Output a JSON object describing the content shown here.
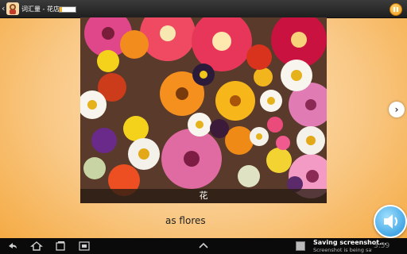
{
  "header": {
    "title": "词汇量 - 花店",
    "progress_fraction": 0.15
  },
  "card": {
    "caption": "花",
    "word": "as flores"
  },
  "statusbar": {
    "notification_title": "Saving screenshot...",
    "notification_subtitle": "Screenshot is being saved",
    "clock": "3:59"
  },
  "colors": {
    "accent": "#f39a14",
    "speaker": "#1f8fd9"
  },
  "icons": {
    "back": "chevron-left-icon",
    "app": "app-icon",
    "pause": "pause-icon",
    "next": "chevron-right-icon",
    "speaker": "speaker-icon",
    "nav_back": "back-arrow-icon",
    "nav_home": "home-icon",
    "nav_recent": "recent-apps-icon",
    "nav_screenshot": "screenshot-icon",
    "nav_up": "chevron-up-icon",
    "notification": "image-icon"
  }
}
